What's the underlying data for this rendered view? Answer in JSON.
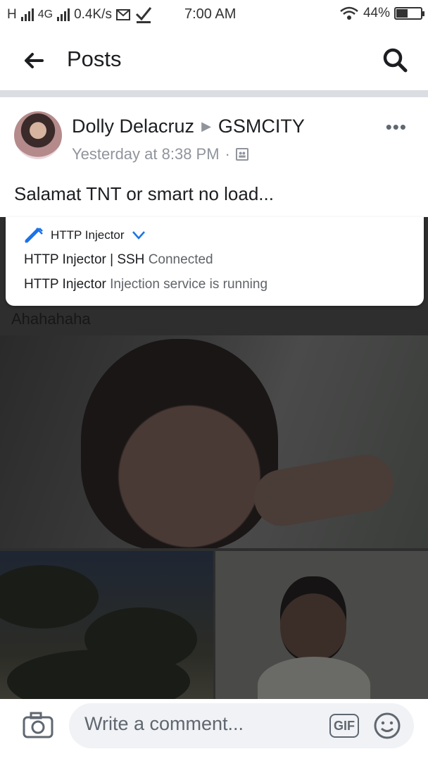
{
  "status_bar": {
    "network_h": "H",
    "network_4g": "4G",
    "speed": "0.4K/s",
    "time": "7:00 AM",
    "battery": "44%",
    "battery_level": 0.44
  },
  "header": {
    "title": "Posts",
    "back_icon": "arrow-left-icon",
    "search_icon": "search-icon"
  },
  "post": {
    "author": "Dolly Delacruz",
    "target": "GSMCITY",
    "timestamp": "Yesterday at 8:38 PM",
    "separator": "·",
    "more_label": "•••",
    "text": "Salamat TNT or smart no load...",
    "text_continued": "Ahahahaha"
  },
  "notification": {
    "app_name": "HTTP Injector",
    "lines": [
      {
        "app": "HTTP Injector | SSH",
        "message": "Connected"
      },
      {
        "app": "HTTP Injector",
        "message": "Injection service is running"
      }
    ],
    "accent": "#1a73e8"
  },
  "comment_bar": {
    "placeholder": "Write a comment...",
    "gif_label": "GIF",
    "camera_icon": "camera-icon",
    "emoji_icon": "smiley-icon"
  }
}
